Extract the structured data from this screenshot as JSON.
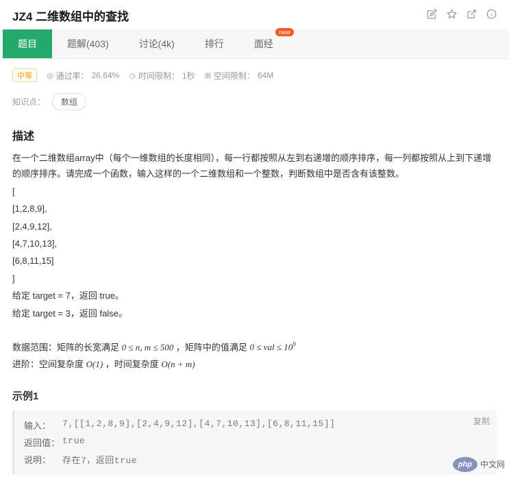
{
  "header": {
    "title": "JZ4 二维数组中的查找"
  },
  "tabs": {
    "items": [
      {
        "label": "题目"
      },
      {
        "label": "题解(403)"
      },
      {
        "label": "讨论(4k)"
      },
      {
        "label": "排行"
      },
      {
        "label": "面经",
        "badge": "new"
      }
    ]
  },
  "meta": {
    "difficulty": "中等",
    "pass_rate_label": "通过率：",
    "pass_rate": "26.64%",
    "time_limit_label": "时间限制：",
    "time_limit": "1秒",
    "memory_limit_label": "空间限制：",
    "memory_limit": "64M"
  },
  "knowledge": {
    "label": "知识点：",
    "tags": [
      "数组"
    ]
  },
  "sections": {
    "description_title": "描述",
    "description_intro": "在一个二维数组array中（每个一维数组的长度相同），每一行都按照从左到右递增的顺序排序，每一列都按照从上到下递增的顺序排序。请完成一个函数，输入这样的一个二维数组和一个整数，判断数组中是否含有该整数。",
    "description_lines": [
      "[",
      "[1,2,8,9],",
      "[2,4,9,12],",
      "[4,7,10,13],",
      "[6,8,11,15]",
      "]",
      "给定 target = 7，返回 true。",
      "给定 target = 3，返回 false。"
    ],
    "data_range_label": "数据范围：矩阵的长宽满足 ",
    "data_range_part2": "，矩阵中的值满足 ",
    "advanced_label": "进阶：空间复杂度 ",
    "advanced_part2": " ，时间复杂度 ",
    "example1_title": "示例1"
  },
  "example": {
    "input_label": "输入：",
    "input_value": "7,[[1,2,8,9],[2,4,9,12],[4,7,10,13],[6,8,11,15]]",
    "return_label": "返回值：",
    "return_value": "true",
    "explain_label": "说明：",
    "explain_value": "存在7，返回true",
    "copy_label": "复制"
  },
  "watermark": {
    "text": "中文网"
  }
}
